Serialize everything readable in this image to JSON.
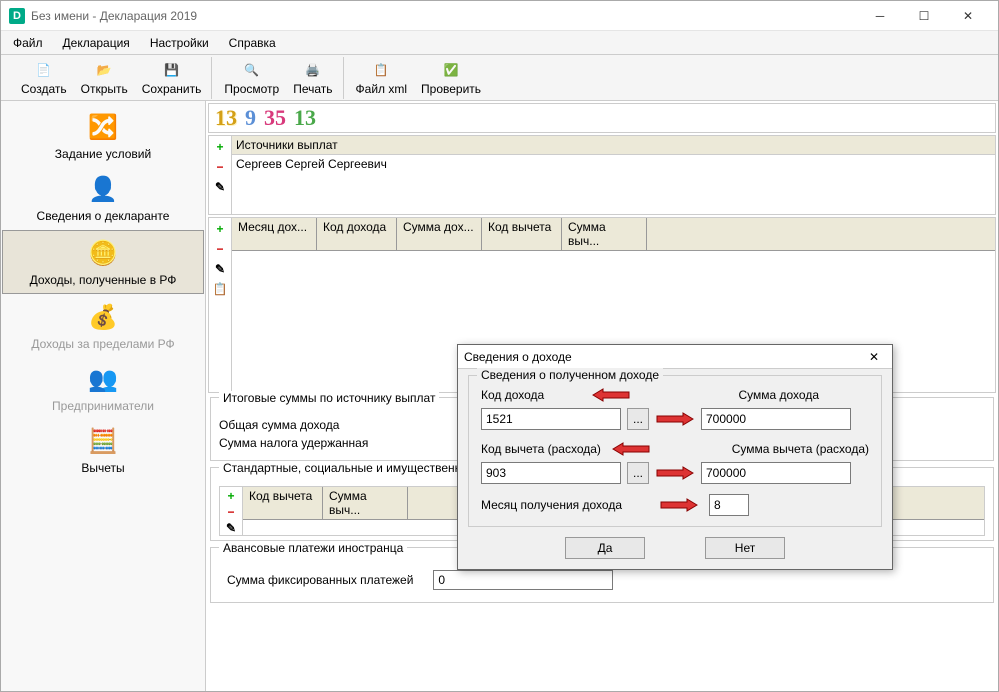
{
  "titlebar": {
    "text": "Без имени - Декларация 2019",
    "logo": "D"
  },
  "menu": {
    "file": "Файл",
    "decl": "Декларация",
    "settings": "Настройки",
    "help": "Справка"
  },
  "toolbar": {
    "create": "Создать",
    "open": "Открыть",
    "save": "Сохранить",
    "preview": "Просмотр",
    "print": "Печать",
    "xml": "Файл xml",
    "check": "Проверить"
  },
  "sidebar": {
    "cond": "Задание условий",
    "declarant": "Сведения о декларанте",
    "income_rf": "Доходы, полученные в РФ",
    "income_abroad": "Доходы за пределами РФ",
    "entrep": "Предприниматели",
    "deduct": "Вычеты"
  },
  "rates": {
    "r1": "13",
    "r2": "9",
    "r3": "35",
    "r4": "13"
  },
  "sources": {
    "header": "Источники выплат",
    "row1": "Сергеев Сергей Сергеевич"
  },
  "income_cols": {
    "c1": "Месяц дох...",
    "c2": "Код дохода",
    "c3": "Сумма дох...",
    "c4": "Код вычета",
    "c5": "Сумма выч..."
  },
  "totals": {
    "title": "Итоговые суммы по источнику выплат",
    "sum_income": "Общая сумма дохода",
    "tax_withheld": "Сумма налога удержанная"
  },
  "deductions_title": "Стандартные, социальные и имущественные вычеты",
  "ded_cols": {
    "c1": "Код вычета",
    "c2": "Сумма выч..."
  },
  "advance": {
    "title": "Авансовые платежи иностранца",
    "label": "Сумма фиксированных платежей",
    "value": "0"
  },
  "dialog": {
    "title": "Сведения о доходе",
    "fieldset": "Сведения о полученном доходе",
    "code_income_label": "Код дохода",
    "sum_income_label": "Сумма дохода",
    "code_income": "1521",
    "sum_income": "700000",
    "code_deduct_label": "Код вычета (расхода)",
    "sum_deduct_label": "Сумма вычета (расхода)",
    "code_deduct": "903",
    "sum_deduct": "700000",
    "month_label": "Месяц получения дохода",
    "month": "8",
    "dots": "...",
    "yes": "Да",
    "no": "Нет"
  }
}
